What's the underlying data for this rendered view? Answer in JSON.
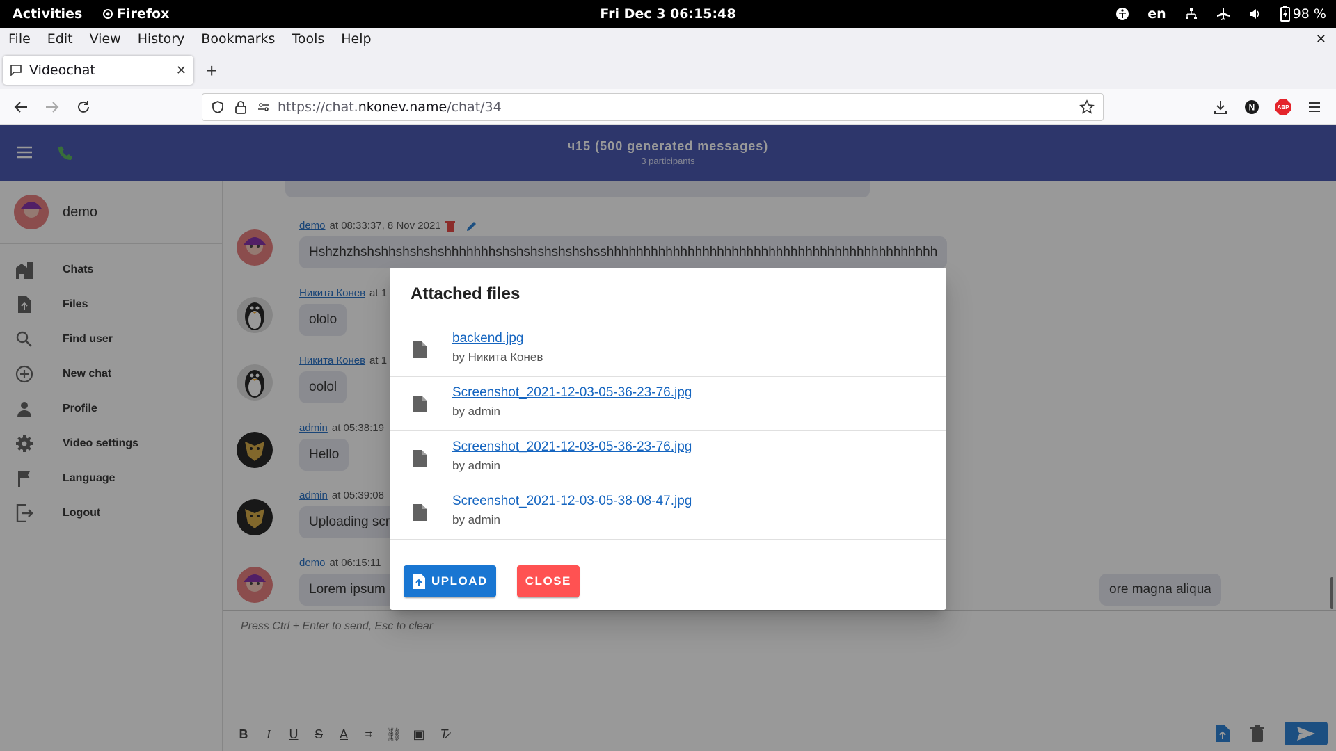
{
  "system": {
    "activities": "Activities",
    "app": "Firefox",
    "clock": "Fri Dec 3  06:15:48",
    "lang": "en",
    "battery": "98 %"
  },
  "menubar": [
    "File",
    "Edit",
    "View",
    "History",
    "Bookmarks",
    "Tools",
    "Help"
  ],
  "tab": {
    "title": "Videochat"
  },
  "url": {
    "prefix": "https://chat.",
    "domain": "nkonev.name",
    "path": "/chat/34"
  },
  "appbar": {
    "title": "ч15 (500 generated messages)",
    "subtitle": "3 participants"
  },
  "sidebar": {
    "user": "demo",
    "items": [
      {
        "label": "Chats",
        "icon": "chats-icon"
      },
      {
        "label": "Files",
        "icon": "files-icon"
      },
      {
        "label": "Find user",
        "icon": "search-icon"
      },
      {
        "label": "New chat",
        "icon": "plus-circle-icon"
      },
      {
        "label": "Profile",
        "icon": "person-icon"
      },
      {
        "label": "Video settings",
        "icon": "gear-icon"
      },
      {
        "label": "Language",
        "icon": "flag-icon"
      },
      {
        "label": "Logout",
        "icon": "logout-icon"
      }
    ]
  },
  "messages": [
    {
      "author": "demo",
      "time": "at 08:33:37, 8 Nov 2021",
      "text": "Hshzhzhshshhshshshshhhhhhhshshshshshshshsshhhhhhhhhhhhhhhhhhhhhhhhhhhhhhhhhhhhhhhhhhhhh"
    },
    {
      "author": "Никита Конев",
      "time": "at 1",
      "text": "ololo"
    },
    {
      "author": "Никита Конев",
      "time": "at 1",
      "text": "oolol"
    },
    {
      "author": "admin",
      "time": "at 05:38:19",
      "text": "Hello"
    },
    {
      "author": "admin",
      "time": "at 05:39:08",
      "text": "Uploading scre"
    },
    {
      "author": "demo",
      "time": "at 06:15:11",
      "text": "Lorem ipsum do",
      "tail": "ore magna aliqua"
    }
  ],
  "editor": {
    "placeholder": "Press Ctrl + Enter to send, Esc to clear"
  },
  "dialog": {
    "title": "Attached files",
    "files": [
      {
        "name": "backend.jpg",
        "by": "by Никита Конев"
      },
      {
        "name": "Screenshot_2021-12-03-05-36-23-76.jpg",
        "by": "by admin"
      },
      {
        "name": "Screenshot_2021-12-03-05-36-23-76.jpg",
        "by": "by admin"
      },
      {
        "name": "Screenshot_2021-12-03-05-38-08-47.jpg",
        "by": "by admin"
      }
    ],
    "upload_label": "UPLOAD",
    "close_label": "CLOSE"
  },
  "colors": {
    "appbar": "#3949ab",
    "upload": "#1976d2",
    "close": "#ff5252",
    "link": "#1565c0"
  }
}
